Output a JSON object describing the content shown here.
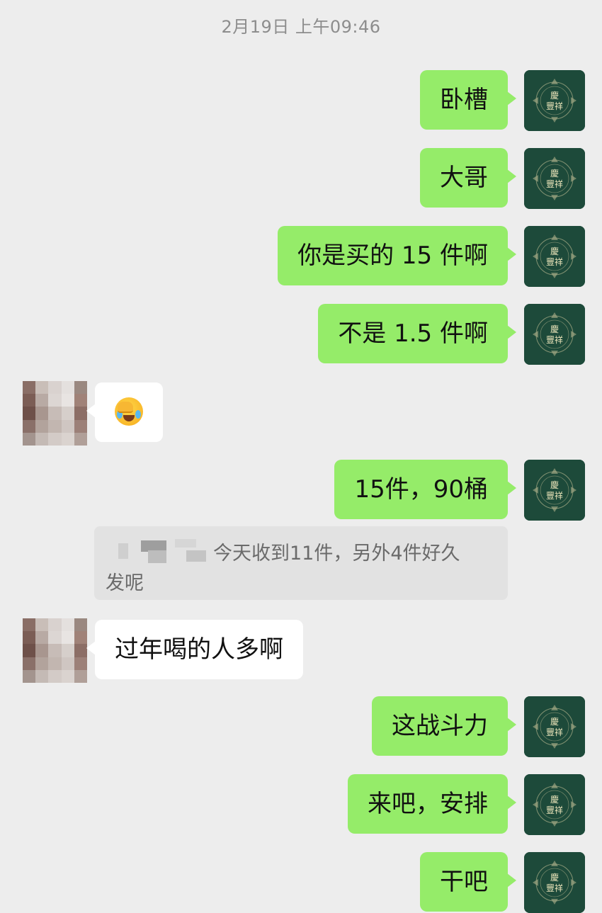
{
  "timestamp": "2月19日 上午09:46",
  "messages": [
    {
      "from": "self",
      "text": "卧槽"
    },
    {
      "from": "self",
      "text": "大哥"
    },
    {
      "from": "self",
      "text": "你是买的 15 件啊"
    },
    {
      "from": "self",
      "text": "不是 1.5 件啊"
    },
    {
      "from": "other",
      "emoji": "facepalm-crying-emoji"
    },
    {
      "from": "self",
      "text": "15件，90桶"
    },
    {
      "from": "quote",
      "line1": "今天收到11件，另外4件好久",
      "line2": "发呢"
    },
    {
      "from": "other",
      "text": "过年喝的人多啊"
    },
    {
      "from": "self",
      "text": "这战斗力"
    },
    {
      "from": "self",
      "text": "来吧，安排"
    },
    {
      "from": "self",
      "text": "干吧"
    }
  ],
  "self_avatar": {
    "icon": "brand-logo-icon",
    "background": "#1d4a3a"
  },
  "other_avatar": {
    "icon": "pixelated-avatar"
  },
  "colors": {
    "background": "#ededed",
    "self_bubble": "#95ec69",
    "other_bubble": "#ffffff",
    "quote_bg": "#e2e2e2"
  }
}
